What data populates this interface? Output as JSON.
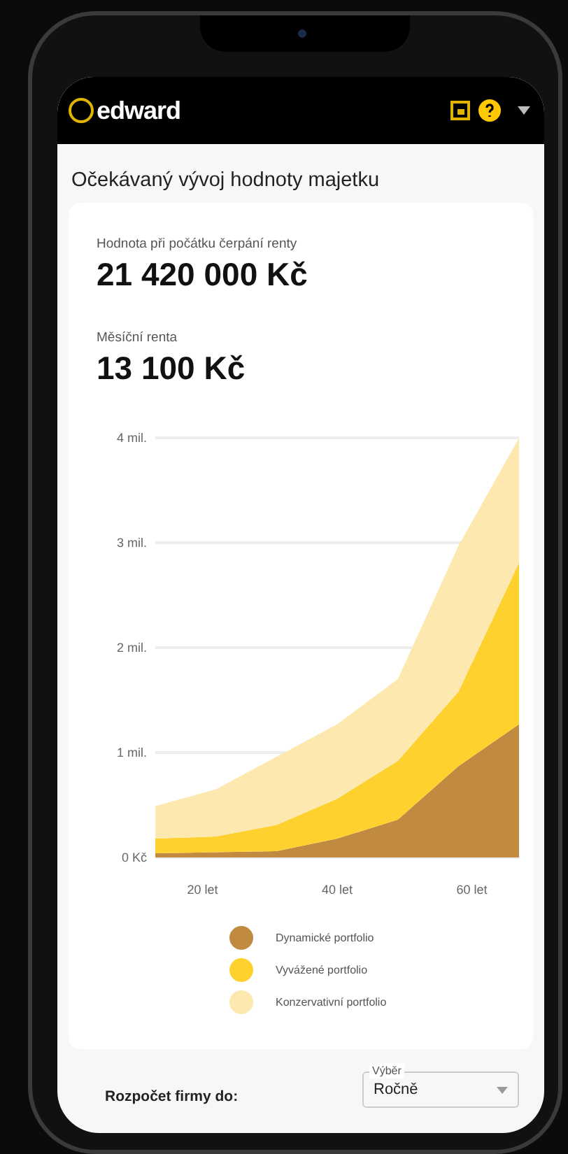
{
  "header": {
    "logo": "edward"
  },
  "title": "Očekávaný vývoj hodnoty majetku",
  "stats": [
    {
      "label": "Hodnota při počátku čerpání renty",
      "value": "21 420 000 Kč"
    },
    {
      "label": "Měsíční renta",
      "value": "13 100 Kč"
    }
  ],
  "chart": {
    "chart_data": {
      "type": "area",
      "stacked": true,
      "x": [
        13,
        22,
        31,
        40,
        49,
        58,
        67
      ],
      "series": [
        {
          "name": "Dynamické portfolio",
          "color": "#c08a40",
          "values": [
            0.04,
            0.05,
            0.06,
            0.18,
            0.36,
            0.87,
            1.27
          ]
        },
        {
          "name": "Vyvážené portfolio",
          "color": "#ffd12e",
          "values": [
            0.14,
            0.15,
            0.25,
            0.38,
            0.56,
            0.71,
            1.54
          ]
        },
        {
          "name": "Konzervativní portfolio",
          "color": "#fde9b0",
          "values": [
            0.31,
            0.45,
            0.65,
            0.71,
            0.78,
            1.39,
            1.19
          ]
        }
      ],
      "grid": true,
      "ylim": [
        0,
        4
      ],
      "yticks": [
        {
          "value": 0,
          "label": "0 Kč"
        },
        {
          "value": 1,
          "label": "1 mil."
        },
        {
          "value": 2,
          "label": "2 mil."
        },
        {
          "value": 3,
          "label": "3 mil."
        },
        {
          "value": 4,
          "label": "4 mil."
        }
      ],
      "xlim": [
        13,
        67
      ],
      "xticks": [
        {
          "value": 20,
          "label": "20 let"
        },
        {
          "value": 40,
          "label": "40 let"
        },
        {
          "value": 60,
          "label": "60 let"
        }
      ]
    }
  },
  "footer": {
    "label": "Rozpočet firmy do:",
    "select": {
      "label": "Výběr",
      "value": "Ročně"
    }
  }
}
